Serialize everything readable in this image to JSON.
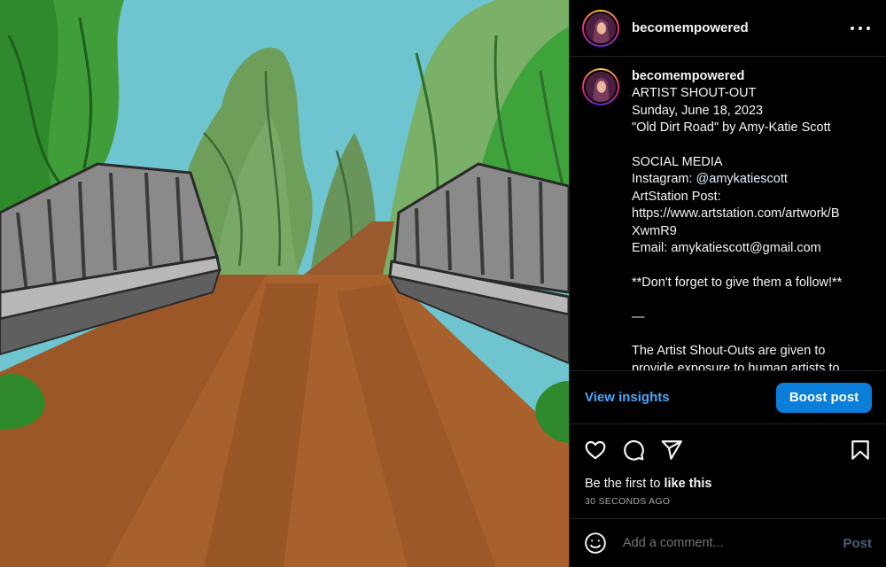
{
  "post": {
    "username": "becomempowered",
    "more_icon": "more-horizontal-icon",
    "avatar_icon": "profile-avatar"
  },
  "caption": {
    "username": "becomempowered",
    "lines": [
      "ARTIST SHOUT-OUT",
      "Sunday, June 18, 2023",
      "\"Old Dirt Road\" by Amy-Katie Scott",
      "",
      "SOCIAL MEDIA",
      "Instagram: ",
      "ArtStation Post:",
      "https://www.artstation.com/artwork/B",
      "XwmR9",
      "Email: amykatiescott@gmail.com",
      "",
      "**Don't forget to give them a follow!**",
      "",
      "—",
      "",
      "The Artist Shout-Outs are given to",
      "provide exposure to human artists to"
    ],
    "instagram_handle": "@amykatiescott"
  },
  "insights": {
    "view_label": "View insights",
    "boost_label": "Boost post"
  },
  "actions": {
    "like_icon": "heart-icon",
    "comment_icon": "comment-icon",
    "share_icon": "share-icon",
    "save_icon": "bookmark-icon"
  },
  "likes": {
    "prefix": "Be the first to ",
    "cta": "like this"
  },
  "timestamp": "30 seconds ago",
  "comment": {
    "emoji_icon": "emoji-icon",
    "placeholder": "Add a comment...",
    "post_label": "Post"
  },
  "colors": {
    "accent_link": "#4aa6ff",
    "boost_bg": "#0a7ed9",
    "background": "#000000",
    "divider": "#262626",
    "sky": "#6ec5cf",
    "dirt": "#a8612c"
  }
}
